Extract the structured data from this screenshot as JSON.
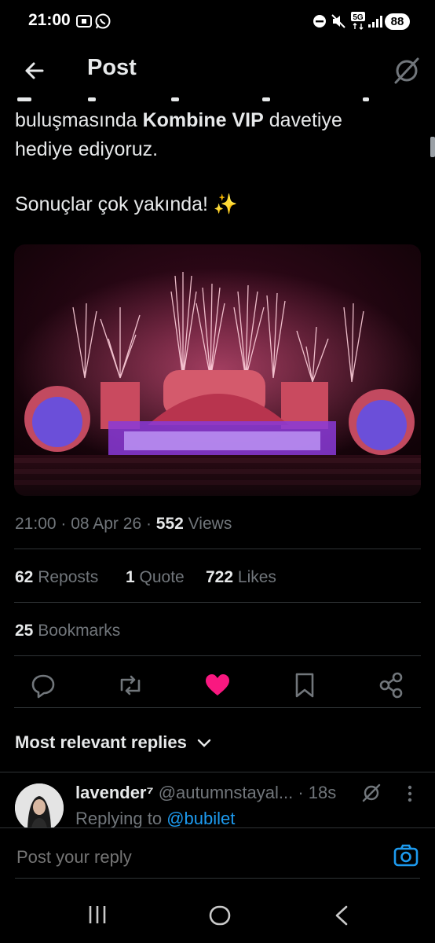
{
  "status_bar": {
    "time": "21:00",
    "battery": "88",
    "network": "5G",
    "icons": [
      "screenshot-icon",
      "whatsapp-icon",
      "dnd-icon",
      "mute-icon",
      "network-5g-icon",
      "signal-icon",
      "battery-icon"
    ]
  },
  "header": {
    "title": "Post",
    "back_icon": "back-arrow-icon",
    "grok_icon": "grok-icon"
  },
  "post": {
    "line1_a": "buluşmasında ",
    "line1_bold": "Kombine VIP",
    "line1_b": " davetiye",
    "line2": "hediye ediyoruz.",
    "line3": "Sonuçlar çok yakında! ✨",
    "meta_time": "21:00 · 08 Apr 26 · ",
    "meta_views_count": "552",
    "meta_views_label": " Views",
    "reposts_count": "62",
    "reposts_label": "Reposts",
    "quote_count": "1",
    "quote_label": "Quote",
    "likes_count": "722",
    "likes_label": "Likes",
    "bookmarks_count": "25",
    "bookmarks_label": "Bookmarks"
  },
  "actions": [
    "reply-icon",
    "repost-icon",
    "like-icon",
    "bookmark-icon",
    "share-icon"
  ],
  "colors": {
    "like": "#f91880",
    "accent": "#1d9bf0",
    "muted": "#71767b",
    "divider": "#2f3336"
  },
  "replies_filter": {
    "label": "Most relevant replies"
  },
  "reply": {
    "name": "lavender⁷",
    "handle": "@autumnstayal...",
    "time": "· 18s",
    "replying_prefix": "Replying to ",
    "replying_handle": "@bubilet"
  },
  "compose": {
    "placeholder": "Post your reply"
  },
  "nav": {
    "icons": [
      "recents-icon",
      "home-icon",
      "back-icon"
    ]
  }
}
